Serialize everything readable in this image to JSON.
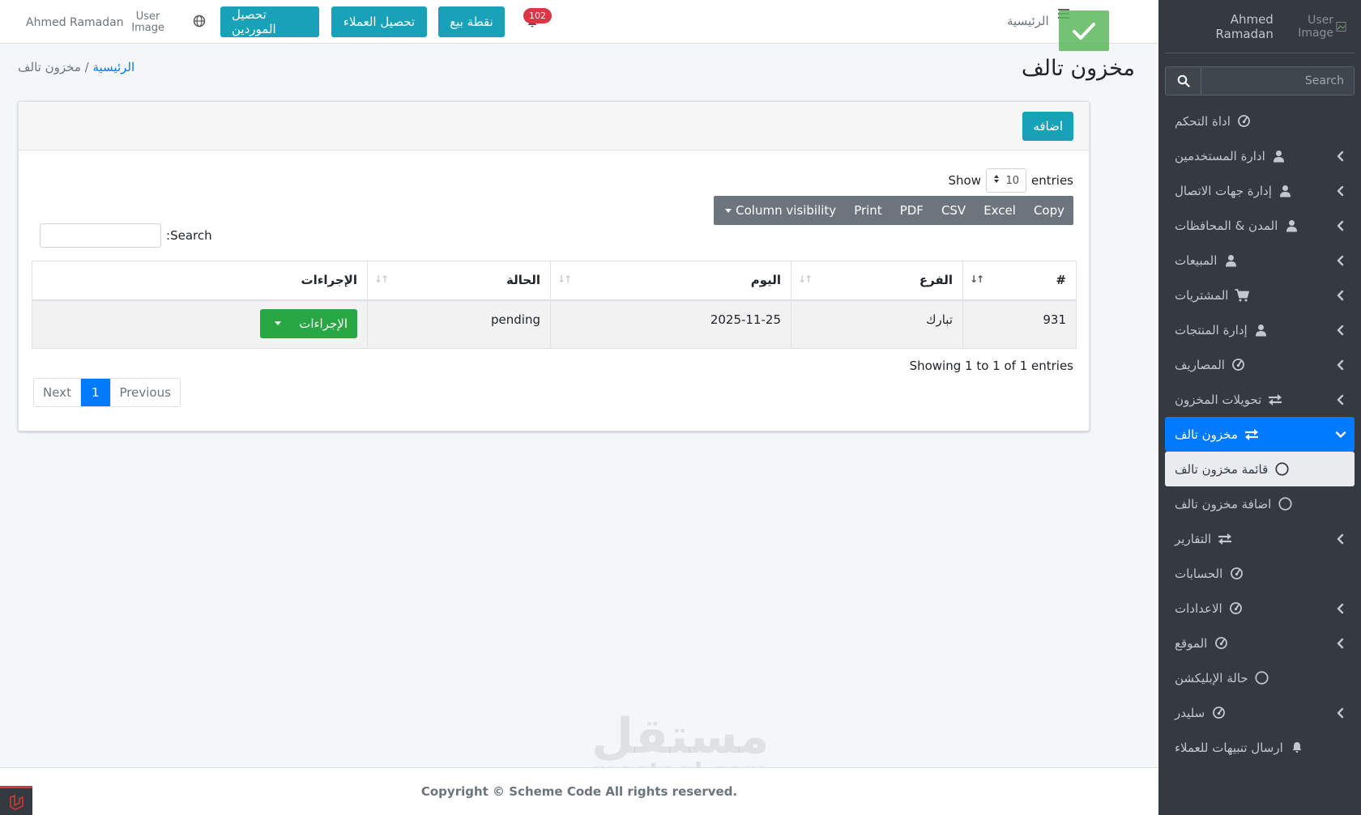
{
  "topbar": {
    "user_name": "Ahmed Ramadan",
    "user_image_alt": "User Image",
    "buttons": [
      "تحصيل الموردين",
      "تحصيل العملاء",
      "نقطة بيع"
    ],
    "notification_count": "102",
    "home_link": "الرئيسية"
  },
  "sidebar": {
    "user_name": "Ahmed Ramadan",
    "user_image_alt": "User Image",
    "search_placeholder": "Search",
    "items": [
      {
        "label": "اداة التحكم",
        "icon": "dashboard-icon",
        "has_children": false
      },
      {
        "label": "ادارة المستخدمين",
        "icon": "user-icon",
        "has_children": true
      },
      {
        "label": "إدارة جهات الاتصال",
        "icon": "user-icon",
        "has_children": true
      },
      {
        "label": "المدن & المحافظات",
        "icon": "user-icon",
        "has_children": true
      },
      {
        "label": "المبيعات",
        "icon": "user-icon",
        "has_children": true
      },
      {
        "label": "المشتريات",
        "icon": "cart-icon",
        "has_children": true
      },
      {
        "label": "إدارة المنتجات",
        "icon": "user-icon",
        "has_children": true
      },
      {
        "label": "المصاريف",
        "icon": "dashboard-icon",
        "has_children": true
      },
      {
        "label": "تحويلات المخزون",
        "icon": "exchange-icon",
        "has_children": true
      },
      {
        "label": "مخزون تالف",
        "icon": "exchange-icon",
        "has_children": true,
        "active": true
      },
      {
        "label": "قائمة مخزون تالف",
        "icon": "circle-icon",
        "sub": true,
        "current": true
      },
      {
        "label": "اضافة مخزون تالف",
        "icon": "circle-icon",
        "sub": true
      },
      {
        "label": "التقارير",
        "icon": "exchange-icon",
        "has_children": true
      },
      {
        "label": "الحسابات",
        "icon": "dashboard-icon",
        "has_children": false
      },
      {
        "label": "الاعدادات",
        "icon": "dashboard-icon",
        "has_children": true
      },
      {
        "label": "الموقع",
        "icon": "dashboard-icon",
        "has_children": true
      },
      {
        "label": "حالة الإبليكشن",
        "icon": "circle-icon",
        "has_children": false
      },
      {
        "label": "سليدر",
        "icon": "dashboard-icon",
        "has_children": true
      },
      {
        "label": "ارسال تنبيهات للعملاء",
        "icon": "bell-icon",
        "has_children": false
      }
    ]
  },
  "page": {
    "title": "مخزون تالف",
    "breadcrumb_home": "الرئيسية",
    "breadcrumb_sep": " / ",
    "breadcrumb_current": "مخزون تالف"
  },
  "card": {
    "add_button": "اضافه",
    "show_label": "Show",
    "entries_value": "10",
    "entries_label": "entries",
    "export_buttons": [
      "Copy",
      "Excel",
      "CSV",
      "PDF",
      "Print",
      "Column visibility"
    ],
    "search_label": "Search:",
    "table": {
      "headers": [
        "#",
        "الفرع",
        "اليوم",
        "الحالة",
        "الإجراءات"
      ],
      "rows": [
        {
          "id": "931",
          "branch": "تبارك",
          "day": "2025-11-25",
          "status": "pending",
          "action": "الإجراءات"
        }
      ]
    },
    "info": "Showing 1 to 1 of 1 entries",
    "pagination": {
      "previous": "Previous",
      "page": "1",
      "next": "Next"
    }
  },
  "footer": {
    "copyright": "Copyright © Scheme Code All rights reserved."
  },
  "watermark": {
    "arabic": "مستقل",
    "latin": "mostaql.com"
  },
  "colors": {
    "primary": "#007bff",
    "info": "#17a2b8",
    "success": "#28a745",
    "sidebar": "#343a40",
    "danger": "#dc3545"
  }
}
